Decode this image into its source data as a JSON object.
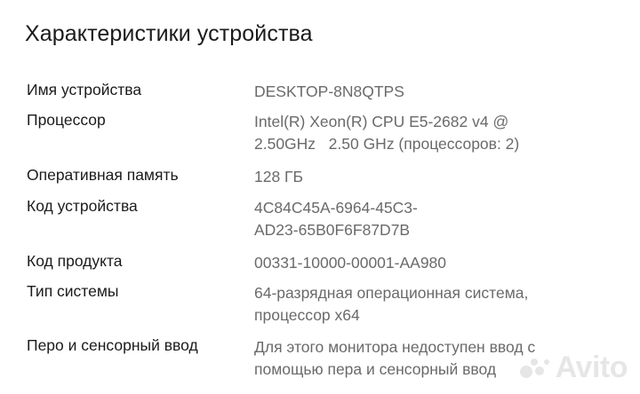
{
  "header": {
    "title": "Характеристики устройства"
  },
  "specs": [
    {
      "label": "Имя устройства",
      "value_lines": [
        "DESKTOP-8N8QTPS"
      ]
    },
    {
      "label": "Процессор",
      "value_lines": [
        "Intel(R) Xeon(R) CPU E5-2682 v4 @",
        "2.50GHz   2.50 GHz (процессоров: 2)"
      ]
    },
    {
      "label": "Оперативная память",
      "value_lines": [
        "128 ГБ"
      ]
    },
    {
      "label": "Код устройства",
      "value_lines": [
        "4C84C45A-6964-45C3-",
        "AD23-65B0F6F87D7B"
      ]
    },
    {
      "label": "Код продукта",
      "value_lines": [
        "00331-10000-00001-AA980"
      ]
    },
    {
      "label": "Тип системы",
      "value_lines": [
        "64-разрядная операционная система,",
        "процессор x64"
      ]
    },
    {
      "label": "Перо и сенсорный ввод",
      "value_lines": [
        "Для этого монитора недоступен ввод с",
        "помощью пера и сенсорный ввод"
      ]
    }
  ],
  "watermark": {
    "text": "Avito",
    "icon": "avito-logo-icon"
  }
}
